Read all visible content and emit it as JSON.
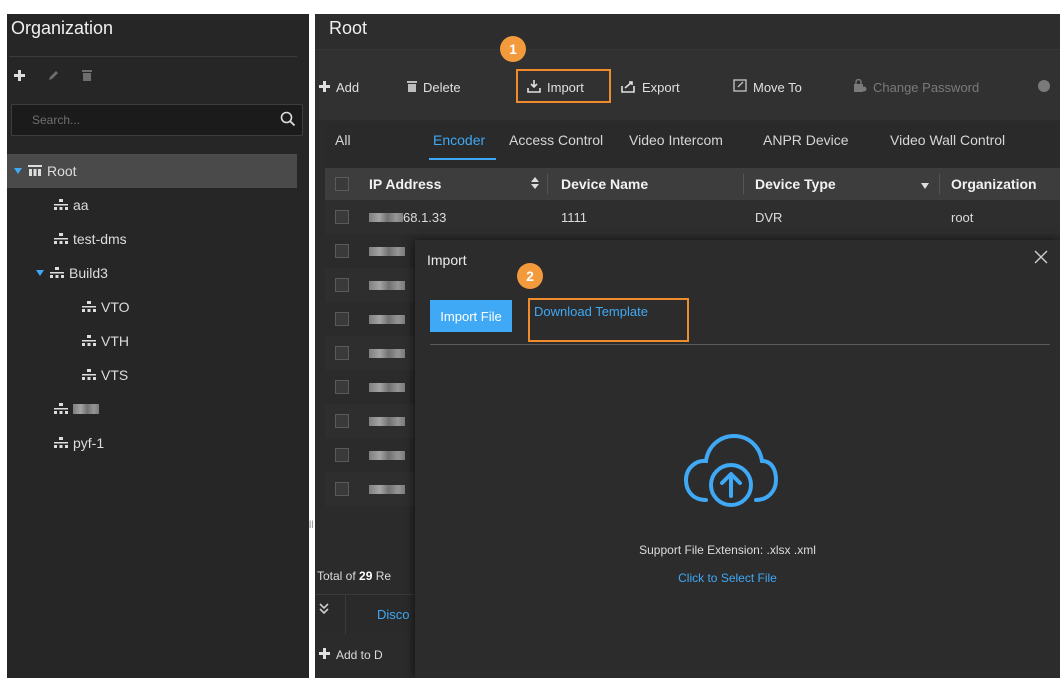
{
  "org": {
    "title": "Organization",
    "search_placeholder": "Search...",
    "tree": [
      {
        "label": "Root",
        "level": 0,
        "expanded": true,
        "selected": true
      },
      {
        "label": "aa",
        "level": 1
      },
      {
        "label": "test-dms",
        "level": 1
      },
      {
        "label": "Build3",
        "level": 1,
        "expanded": true
      },
      {
        "label": "VTO",
        "level": 2
      },
      {
        "label": "VTH",
        "level": 2
      },
      {
        "label": "VTS",
        "level": 2
      },
      {
        "label": "",
        "level": 1,
        "blurred": true
      },
      {
        "label": "pyf-1",
        "level": 1
      }
    ]
  },
  "main": {
    "title": "Root",
    "toolbar": {
      "add": "Add",
      "delete": "Delete",
      "import": "Import",
      "export": "Export",
      "move_to": "Move To",
      "change_password": "Change Password"
    },
    "tabs": [
      "All",
      "Encoder",
      "Access Control",
      "Video Intercom",
      "ANPR Device",
      "Video Wall Control"
    ],
    "active_tab": "Encoder",
    "table": {
      "headers": {
        "ip": "IP Address",
        "name": "Device Name",
        "type": "Device Type",
        "org": "Organization"
      },
      "rows": [
        {
          "ip": "68.1.33",
          "name": "1111",
          "type": "DVR",
          "org": "root"
        }
      ]
    },
    "footer": {
      "prefix": "Total of ",
      "count": "29",
      "suffix": " Re"
    },
    "bottom_tab": "Disco",
    "add_to": "Add to D"
  },
  "dialog": {
    "title": "Import",
    "import_file": "Import File",
    "download_template": "Download Template",
    "support_text": "Support File Extension: .xlsx .xml",
    "select_link": "Click to Select File"
  },
  "callouts": {
    "step1": "1",
    "step2": "2"
  },
  "colors": {
    "accent": "#3fa9f5",
    "callout": "#f08c2e",
    "panel": "#262626"
  }
}
